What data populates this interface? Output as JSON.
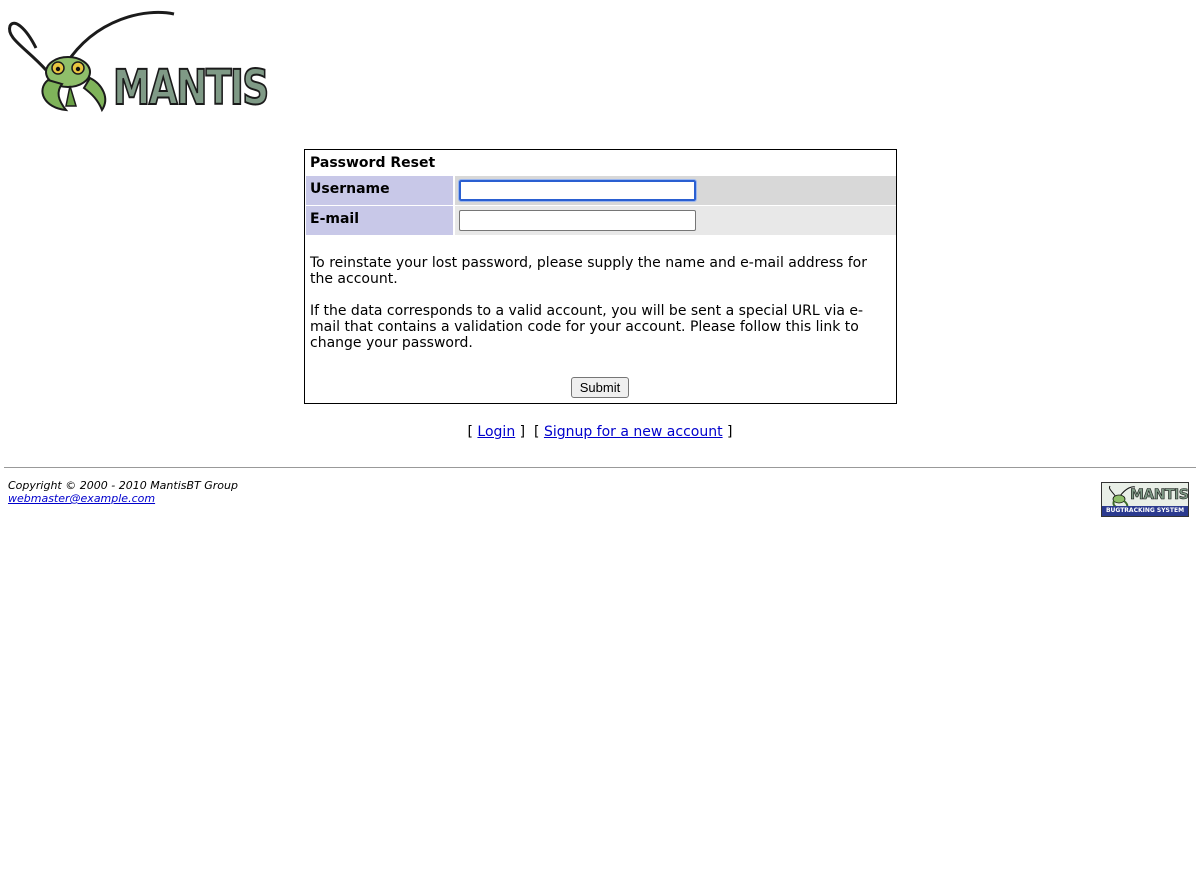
{
  "logo": {
    "text": "MANTIS"
  },
  "form": {
    "title": "Password Reset",
    "username_label": "Username",
    "email_label": "E-mail",
    "username_value": "",
    "email_value": "",
    "info_paragraph_1": "To reinstate your lost password, please supply the name and e-mail address for the account.",
    "info_paragraph_2": "If the data corresponds to a valid account, you will be sent a special URL via e-mail that contains a validation code for your account. Please follow this link to change your password.",
    "submit_label": "Submit"
  },
  "links": {
    "login": "Login",
    "signup": "Signup for a new account"
  },
  "footer": {
    "copyright": "Copyright © 2000 - 2010 MantisBT Group",
    "email": "webmaster@example.com"
  },
  "badge": {
    "word": "MANTIS",
    "subtitle": "BUGTRACKING SYSTEM"
  },
  "colors": {
    "label_bg": "#c8c8e8",
    "row1_bg": "#d8d8d8",
    "row2_bg": "#e8e8e8",
    "link": "#0000cc"
  }
}
